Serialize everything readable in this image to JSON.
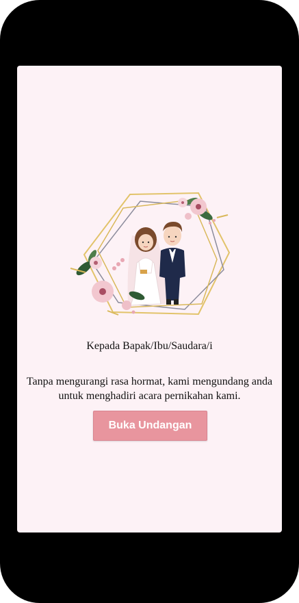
{
  "invitation": {
    "greeting": "Kepada Bapak/Ibu/Saudara/i",
    "message": "Tanpa mengurangi rasa hormat, kami mengundang anda untuk menghadiri acara pernikahan kami.",
    "open_button_label": "Buka Undangan"
  },
  "colors": {
    "background": "#fdf2f6",
    "button": "#e8959e",
    "frame_gold": "#e2c36a",
    "frame_gray": "#8c8c9c"
  },
  "icons": [
    "couple-illustration",
    "flower-decoration-icon",
    "geometric-frame-icon"
  ]
}
